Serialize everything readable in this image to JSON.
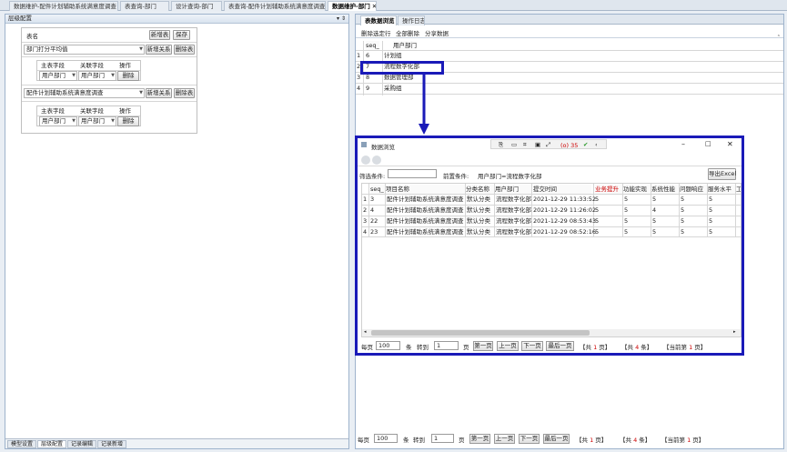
{
  "tabs": [
    {
      "label": "数据维护-配件计划辅助系统满意度调查"
    },
    {
      "label": "表查询-部门"
    },
    {
      "label": "设计查询-部门"
    },
    {
      "label": "表查询-配件计划辅助系统满意度调查"
    },
    {
      "label": "数据维护-部门",
      "close": "✕"
    }
  ],
  "left": {
    "title": "层级配置",
    "pin": "▾ ⇕",
    "table_name_label": "表名",
    "new_table": "新增表",
    "save": "保存",
    "tables": [
      {
        "name": "部门打分平均值",
        "new_relation": "新增关系",
        "delete_table": "删除表",
        "headers": [
          "主表字段",
          "关联字段",
          "操作"
        ],
        "rows": [
          {
            "main": "用户部门",
            "rel": "用户部门",
            "op": "删除"
          }
        ]
      },
      {
        "name": "配件计划辅助系统满意度调查",
        "new_relation": "新增关系",
        "delete_table": "删除表",
        "headers": [
          "主表字段",
          "关联字段",
          "操作"
        ],
        "rows": [
          {
            "main": "用户部门",
            "rel": "用户部门",
            "op": "删除"
          }
        ]
      }
    ],
    "bottom_tabs": [
      "模型设置",
      "层级配置",
      "记录编辑",
      "记录新增"
    ]
  },
  "right": {
    "tabs": [
      "表数据浏览",
      "操作日志"
    ],
    "toolbar": [
      "删除选定行",
      "全部删除",
      "分享数据"
    ],
    "headers": [
      "seq_",
      "用户部门"
    ],
    "rows": [
      {
        "idx": "1",
        "seq": "6",
        "dept": "计划组"
      },
      {
        "idx": "2",
        "seq": "7",
        "dept": "流程数字化部"
      },
      {
        "idx": "3",
        "seq": "8",
        "dept": "数据管理部"
      },
      {
        "idx": "4",
        "seq": "9",
        "dept": "采购组"
      }
    ],
    "pager": {
      "per_page": "每页",
      "per_page_value": "100",
      "unit": "条",
      "goto": "转到",
      "goto_value": "1",
      "page": "页",
      "first": "第一页",
      "prev": "上一页",
      "next": "下一页",
      "last": "最后一页",
      "total_pages_pre": "【共",
      "total_pages": "1",
      "total_pages_post": "页】",
      "total_rows_pre": "【共",
      "total_rows": "4",
      "total_rows_post": "条】",
      "current_pre": "【当前第",
      "current": "1",
      "current_post": "页】"
    }
  },
  "popup": {
    "title": "数据浏览",
    "tray_count": "(o) 35",
    "filter_label": "筛选条件:",
    "filter_value": "",
    "prev_condition_label": "前置条件:",
    "prev_condition": "用户部门=流程数字化部",
    "export": "导出Excel",
    "headers": [
      "seq_",
      "项目名称",
      "分类名称",
      "用户部门",
      "提交时间",
      "业务提升",
      "功能实现",
      "系统性能",
      "问题响应",
      "服务水平",
      "工"
    ],
    "rows": [
      {
        "idx": "1",
        "cells": [
          "3",
          "配件计划辅助系统满意度调查",
          "默认分类",
          "流程数字化部",
          "2021-12-29 11:33:52",
          "5",
          "5",
          "5",
          "5",
          "5",
          ""
        ]
      },
      {
        "idx": "2",
        "cells": [
          "4",
          "配件计划辅助系统满意度调查",
          "默认分类",
          "流程数字化部",
          "2021-12-29 11:26:02",
          "5",
          "5",
          "4",
          "5",
          "5",
          ""
        ]
      },
      {
        "idx": "3",
        "cells": [
          "22",
          "配件计划辅助系统满意度调查",
          "默认分类",
          "流程数字化部",
          "2021-12-29 08:53:43",
          "5",
          "5",
          "5",
          "5",
          "5",
          ""
        ]
      },
      {
        "idx": "4",
        "cells": [
          "23",
          "配件计划辅助系统满意度调查",
          "默认分类",
          "流程数字化部",
          "2021-12-29 08:52:16",
          "5",
          "5",
          "5",
          "5",
          "5",
          ""
        ]
      }
    ],
    "pager": {
      "per_page": "每页",
      "per_page_value": "100",
      "unit": "条",
      "goto": "转到",
      "goto_value": "1",
      "page": "页",
      "first": "第一页",
      "prev": "上一页",
      "next": "下一页",
      "last": "最后一页",
      "total_pages_pre": "【共",
      "total_pages": "1",
      "total_pages_post": "页】",
      "total_rows_pre": "【共",
      "total_rows": "4",
      "total_rows_post": "条】",
      "current_pre": "【当前第",
      "current": "1",
      "current_post": "页】"
    }
  },
  "colors": {
    "highlight": "#1a1ab8",
    "red_value": "#cc0000"
  }
}
